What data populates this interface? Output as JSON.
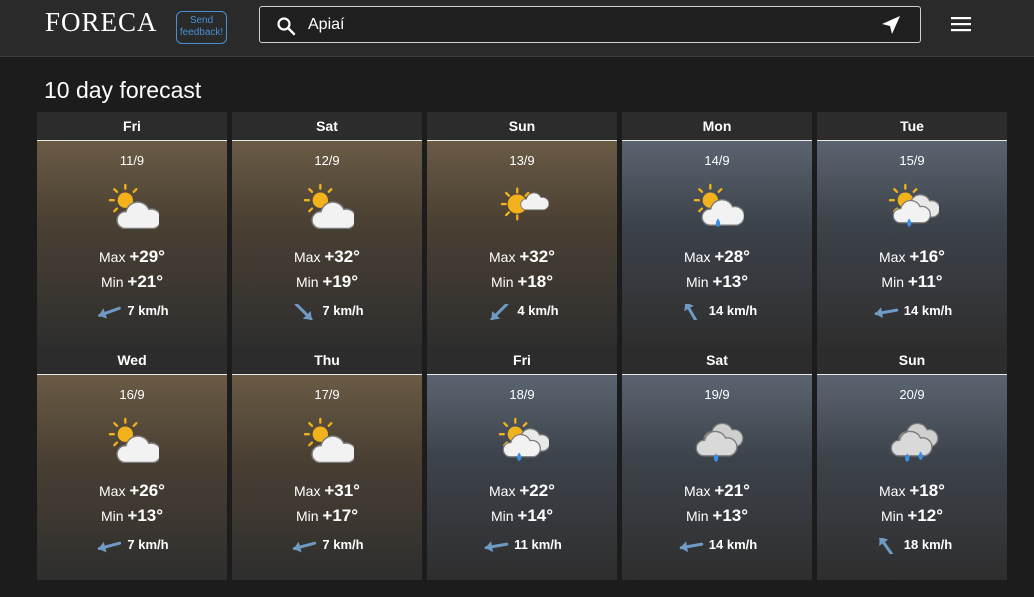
{
  "header": {
    "logo": "FORECA",
    "feedback_line1": "Send",
    "feedback_line2": "feedback!",
    "search_value": "Apiaí"
  },
  "page_title": "10 day forecast",
  "labels": {
    "max": "Max",
    "min": "Min"
  },
  "colors": {
    "accent": "#4a8fd4",
    "rain": "#3a8ee6",
    "sun": "#f2b21b",
    "wind_arrow": "#6f9ac4"
  },
  "rows": [
    [
      {
        "day": "Fri",
        "date": "11/9",
        "icon": "partly-cloudy-icon",
        "bg": "warm",
        "max": "+29°",
        "min": "+21°",
        "wind": "7 km/h",
        "wind_dir_deg": 250
      },
      {
        "day": "Sat",
        "date": "12/9",
        "icon": "partly-cloudy-icon",
        "bg": "warm",
        "max": "+32°",
        "min": "+19°",
        "wind": "7 km/h",
        "wind_dir_deg": 135
      },
      {
        "day": "Sun",
        "date": "13/9",
        "icon": "mostly-sunny-icon",
        "bg": "warm",
        "max": "+32°",
        "min": "+18°",
        "wind": "4 km/h",
        "wind_dir_deg": 225
      },
      {
        "day": "Mon",
        "date": "14/9",
        "icon": "sun-cloud-rain-icon",
        "bg": "cool",
        "max": "+28°",
        "min": "+13°",
        "wind": "14 km/h",
        "wind_dir_deg": 330
      },
      {
        "day": "Tue",
        "date": "15/9",
        "icon": "sun-clouds-rain-icon",
        "bg": "cool",
        "max": "+16°",
        "min": "+11°",
        "wind": "14 km/h",
        "wind_dir_deg": 260
      }
    ],
    [
      {
        "day": "Wed",
        "date": "16/9",
        "icon": "partly-cloudy-icon",
        "bg": "warm",
        "max": "+26°",
        "min": "+13°",
        "wind": "7 km/h",
        "wind_dir_deg": 255
      },
      {
        "day": "Thu",
        "date": "17/9",
        "icon": "partly-cloudy-icon",
        "bg": "warm",
        "max": "+31°",
        "min": "+17°",
        "wind": "7 km/h",
        "wind_dir_deg": 255
      },
      {
        "day": "Fri",
        "date": "18/9",
        "icon": "sun-clouds-rain-icon",
        "bg": "cool",
        "max": "+22°",
        "min": "+14°",
        "wind": "11 km/h",
        "wind_dir_deg": 260
      },
      {
        "day": "Sat",
        "date": "19/9",
        "icon": "cloud-rain-icon",
        "bg": "cool",
        "max": "+21°",
        "min": "+13°",
        "wind": "14 km/h",
        "wind_dir_deg": 260
      },
      {
        "day": "Sun",
        "date": "20/9",
        "icon": "cloud-rain-heavy-icon",
        "bg": "cool",
        "max": "+18°",
        "min": "+12°",
        "wind": "18 km/h",
        "wind_dir_deg": 325
      }
    ]
  ]
}
